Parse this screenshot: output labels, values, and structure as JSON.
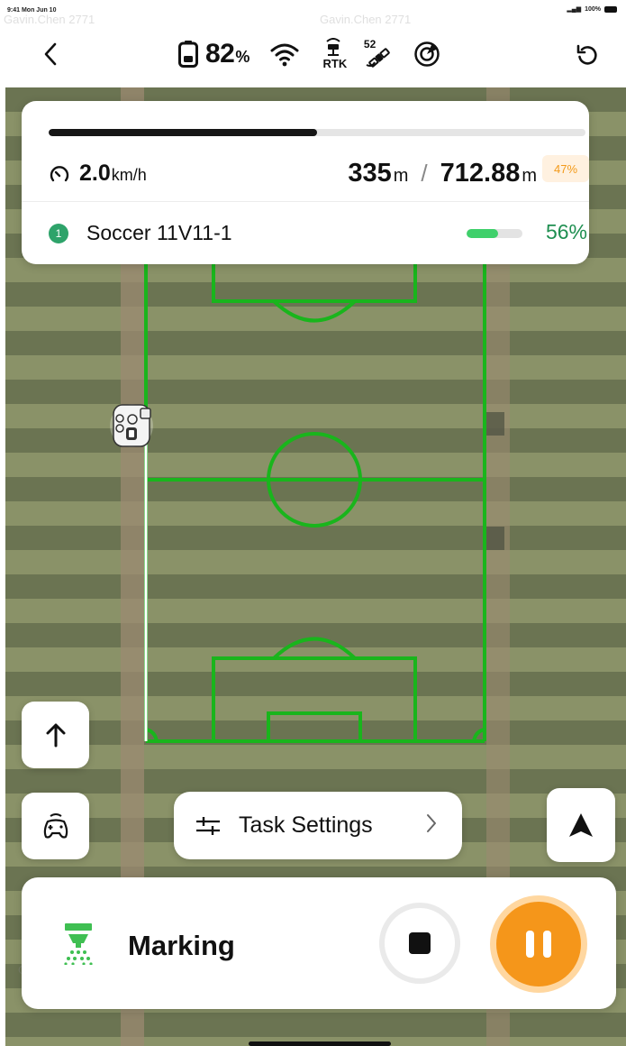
{
  "status_bar": {
    "time": "9:41",
    "date": "Mon Jun 10",
    "battery_text": "100%"
  },
  "toolbar": {
    "battery_value": "82",
    "battery_unit": "%",
    "rtk_label": "RTK",
    "satellite_count": "52",
    "icons": [
      "back-icon",
      "battery-icon",
      "wifi-icon",
      "rtk-icon",
      "satellite-icon",
      "radar-icon",
      "refresh-icon"
    ]
  },
  "progress": {
    "overall_fraction": 0.5,
    "speed_value": "2.0",
    "speed_unit": "km/h",
    "distance_done": "335",
    "distance_done_unit": "m",
    "separator": "/",
    "distance_total": "712.88",
    "distance_total_unit": "m",
    "percent_badge": "47%",
    "task_number": "1",
    "task_name": "Soccer 11V11-1",
    "task_fraction": 0.56,
    "task_percent": "56%"
  },
  "controls": {
    "task_settings_label": "Task Settings",
    "mode_label": "Marking"
  },
  "watermark": "Gavin.Chen 2771",
  "colors": {
    "accent_orange": "#f5961a",
    "accent_green": "#3fd06b",
    "field_line_green": "#19b51c",
    "badge_orange_bg": "#fff1e0"
  }
}
